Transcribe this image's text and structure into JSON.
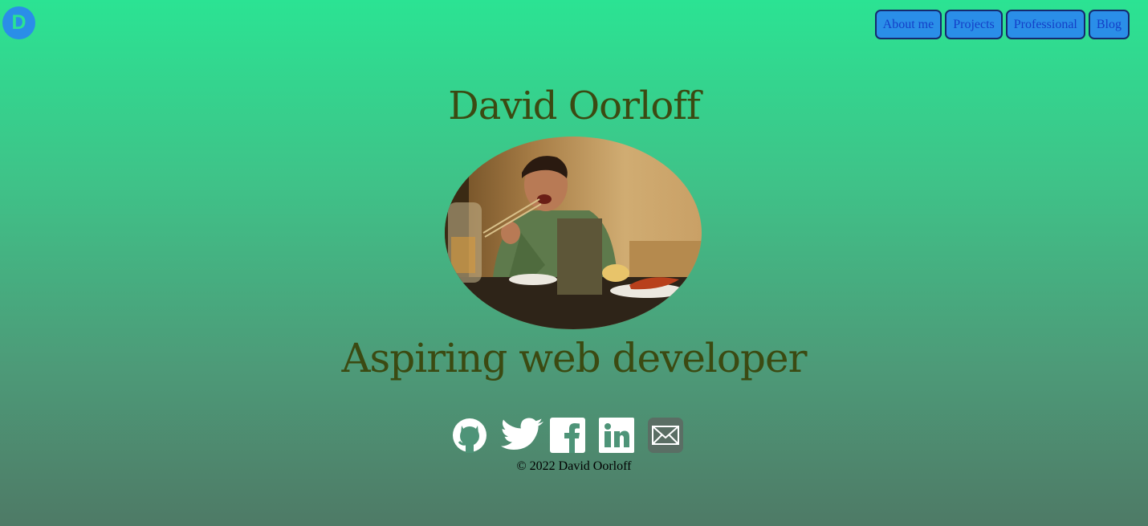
{
  "logo": {
    "letter": "D"
  },
  "nav": {
    "items": [
      {
        "label": "About me"
      },
      {
        "label": "Projects"
      },
      {
        "label": "Professional"
      },
      {
        "label": "Blog"
      }
    ]
  },
  "hero": {
    "name": "David Oorloff",
    "tagline": "Aspiring web developer"
  },
  "social": {
    "icons": [
      "github-icon",
      "twitter-icon",
      "facebook-icon",
      "linkedin-icon",
      "email-icon"
    ]
  },
  "footer": {
    "text": "© 2022 David Oorloff"
  },
  "colors": {
    "background_top": "#2be393",
    "background_bottom": "#4e7a66",
    "nav_button": "#2a8ee8",
    "nav_text": "#1440c8",
    "heading_text": "#3b4a12"
  }
}
